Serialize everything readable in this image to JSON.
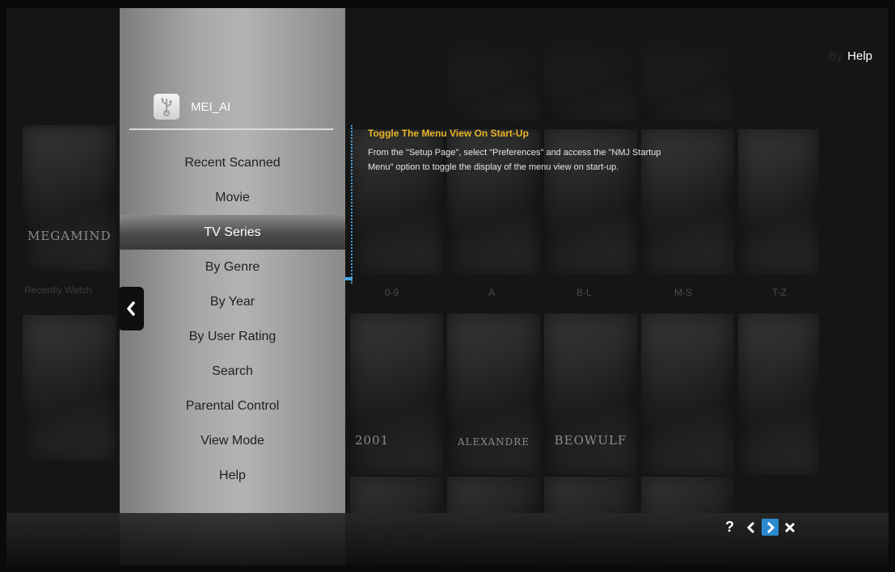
{
  "header": {
    "help_label": "Help",
    "hint_label": "By"
  },
  "menu": {
    "title": "MEI_AI",
    "items": [
      {
        "label": "Recent Scanned",
        "selected": false
      },
      {
        "label": "Movie",
        "selected": false
      },
      {
        "label": "TV Series",
        "selected": true
      },
      {
        "label": "By Genre",
        "selected": false
      },
      {
        "label": "By Year",
        "selected": false
      },
      {
        "label": "By User Rating",
        "selected": false
      },
      {
        "label": "Search",
        "selected": false
      },
      {
        "label": "Parental Control",
        "selected": false
      },
      {
        "label": "View Mode",
        "selected": false
      },
      {
        "label": "Help",
        "selected": false
      }
    ]
  },
  "tooltip": {
    "title": "Toggle The Menu View On Start-Up",
    "body": "From the \"Setup Page\", select \"Preferences\" and access the \"NMJ Startup Menu\" option to toggle the display of the menu view on start-up."
  },
  "background": {
    "recent_label": "Recently Watch",
    "alpha_tabs": [
      "0-9",
      "A",
      "B-L",
      "M-S",
      "T-Z"
    ],
    "poster_texts": [
      "MEGAMIND",
      "2001",
      "ALEXANDRE",
      "BEOWULF",
      "2012"
    ]
  },
  "controls": {
    "help": "?",
    "prev": "<",
    "next": ">",
    "close": "x"
  },
  "colors": {
    "accent": "#2a8ad0",
    "tip_title": "#e8b628"
  }
}
